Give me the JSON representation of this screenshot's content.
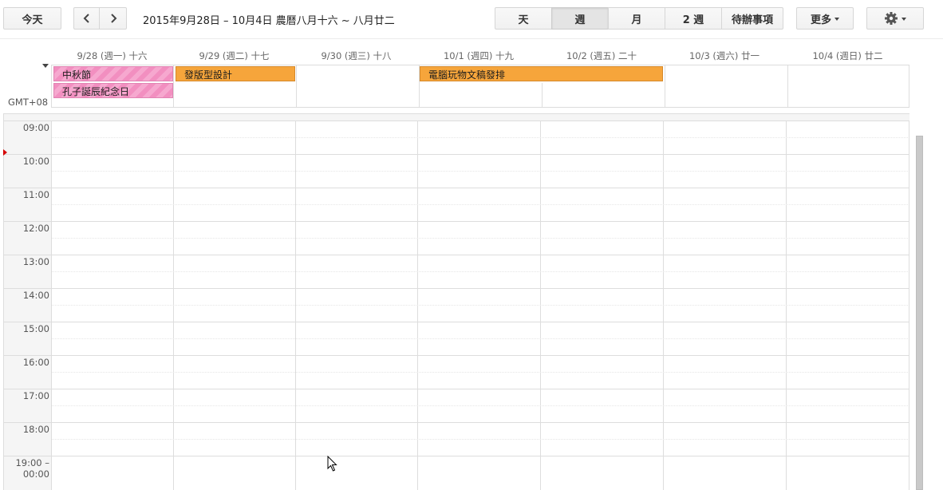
{
  "toolbar": {
    "today": "今天",
    "prev_icon": "chevron-left-icon",
    "next_icon": "chevron-right-icon",
    "date_range": "2015年9月28日 – 10月4日 農曆八月十六 ~ 八月廿二",
    "views": [
      "天",
      "週",
      "月",
      "2 週",
      "待辦事項"
    ],
    "selected_view": "週",
    "more": "更多",
    "settings_icon": "gear-icon"
  },
  "days": [
    "9/28 (週一) 十六",
    "9/29 (週二) 十七",
    "9/30 (週三) 十八",
    "10/1 (週四) 十九",
    "10/2 (週五) 二十",
    "10/3 (週六) 廿一",
    "10/4 (週日) 廿二"
  ],
  "timezone": "GMT+08",
  "allday_events": [
    {
      "title": "中秋節",
      "color": "#f28fc0"
    },
    {
      "title": "孔子誕辰紀念日",
      "color": "#f28fc0"
    },
    {
      "title": "發版型設計",
      "color": "#f6a53b"
    },
    {
      "title": "電腦玩物文稿發排",
      "color": "#f6a53b"
    }
  ],
  "hours": [
    "09:00",
    "10:00",
    "11:00",
    "12:00",
    "13:00",
    "14:00",
    "15:00",
    "16:00",
    "17:00",
    "18:00"
  ],
  "last_slot": [
    "19:00 –",
    "00:00"
  ],
  "colors": {
    "accent_pink": "#f28fc0",
    "accent_orange": "#f6a53b",
    "now_marker": "#d50000"
  }
}
